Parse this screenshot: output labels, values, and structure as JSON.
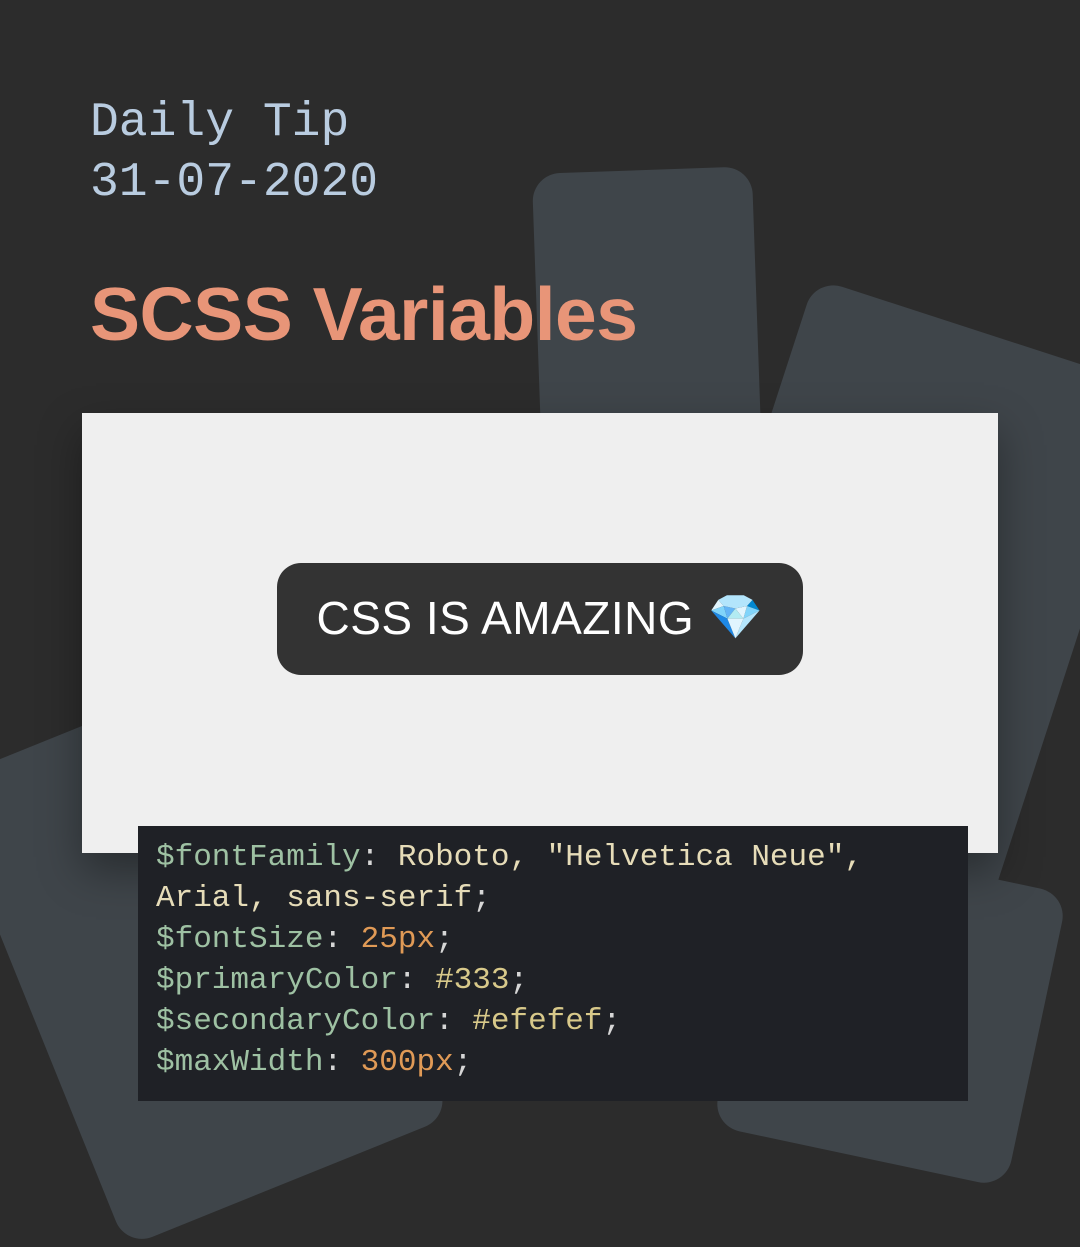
{
  "header": {
    "kicker": "Daily Tip",
    "date": "31-07-2020",
    "title": "SCSS Variables"
  },
  "preview": {
    "pill_text": "CSS IS AMAZING",
    "pill_emoji": "💎"
  },
  "code": {
    "vars": {
      "fontFamily": "$fontFamily",
      "fontSize": "$fontSize",
      "primaryColor": "$primaryColor",
      "secondaryColor": "$secondaryColor",
      "maxWidth": "$maxWidth"
    },
    "values": {
      "fontFamily_idents": "Roboto, \"Helvetica Neue\", Arial, sans-serif",
      "fontSize": "25px",
      "primaryColor": "#333",
      "secondaryColor": "#efefef",
      "maxWidth": "300px"
    },
    "punct": {
      "colon_sp": ": ",
      "semi": ";"
    }
  },
  "colors": {
    "bg": "#2c2c2c",
    "kicker": "#b9cce0",
    "title": "#e89578",
    "pill_bg": "#333333",
    "preview_bg": "#efefef",
    "code_bg": "#1f2126"
  }
}
